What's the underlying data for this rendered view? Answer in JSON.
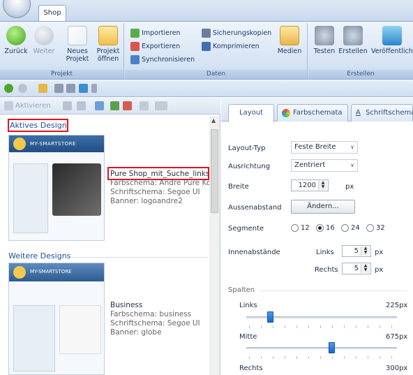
{
  "ribbon": {
    "tab": "Shop",
    "groups": {
      "projekt": {
        "label": "Projekt",
        "buttons": {
          "back": "Zurück",
          "forward": "Weiter",
          "new": "Neues Projekt",
          "open": "Projekt öffnen"
        }
      },
      "daten": {
        "label": "Daten",
        "buttons": {
          "import": "Importieren",
          "export": "Exportieren",
          "sync": "Synchronisieren",
          "backups": "Sicherungskopien",
          "compress": "Komprimieren",
          "media": "Medien"
        }
      },
      "erstellen": {
        "label": "Erstellen",
        "buttons": {
          "test": "Testen",
          "build": "Erstellen",
          "publish": "Veröffentliche"
        }
      }
    }
  },
  "left": {
    "toolbar": {
      "activate": "Aktivieren"
    },
    "active_title": "Aktives Design",
    "active": {
      "name": "Pure Shop_mit_Suche_links",
      "color": "Farbschema: Andre Pure Kop",
      "font": "Schriftschema: Segoe UI",
      "banner": "Banner: logoandre2"
    },
    "more_title": "Weitere Designs",
    "other": {
      "name": "Business",
      "color": "Farbschema: business",
      "font": "Schriftschema: Segoe UI",
      "banner": "Banner: globe"
    },
    "thumb_brand": "MY-SMARTSTORE",
    "thumb_brand2": "MY-SMARTSTORE"
  },
  "right": {
    "tabs": [
      "Layout",
      "Farbschemata",
      "Schriftschemat"
    ],
    "props": {
      "layout_type_label": "Layout-Typ",
      "layout_type_value": "Feste Breite",
      "alignment_label": "Ausrichtung",
      "alignment_value": "Zentriert",
      "width_label": "Breite",
      "width_value": "1200",
      "width_unit": "px",
      "margin_label": "Aussenabstand",
      "margin_button": "Ändern...",
      "segments_label": "Segmente",
      "segments": [
        "12",
        "16",
        "24",
        "32"
      ],
      "segments_selected": "16",
      "padding_label": "Innenabstände",
      "left_label": "Links",
      "left_value": "5",
      "right_label": "Rechts",
      "right_value": "5",
      "px": "px",
      "columns_label": "Spalten",
      "col_left_label": "Links",
      "col_left_value": "225px",
      "col_mid_label": "Mitte",
      "col_mid_value": "675px",
      "col_right_label": "Rechts",
      "col_right_value": "300px"
    }
  },
  "colors": {
    "accent": "#1d4f9e",
    "highlight": "#e0141c",
    "slider": "#1b67c9"
  }
}
